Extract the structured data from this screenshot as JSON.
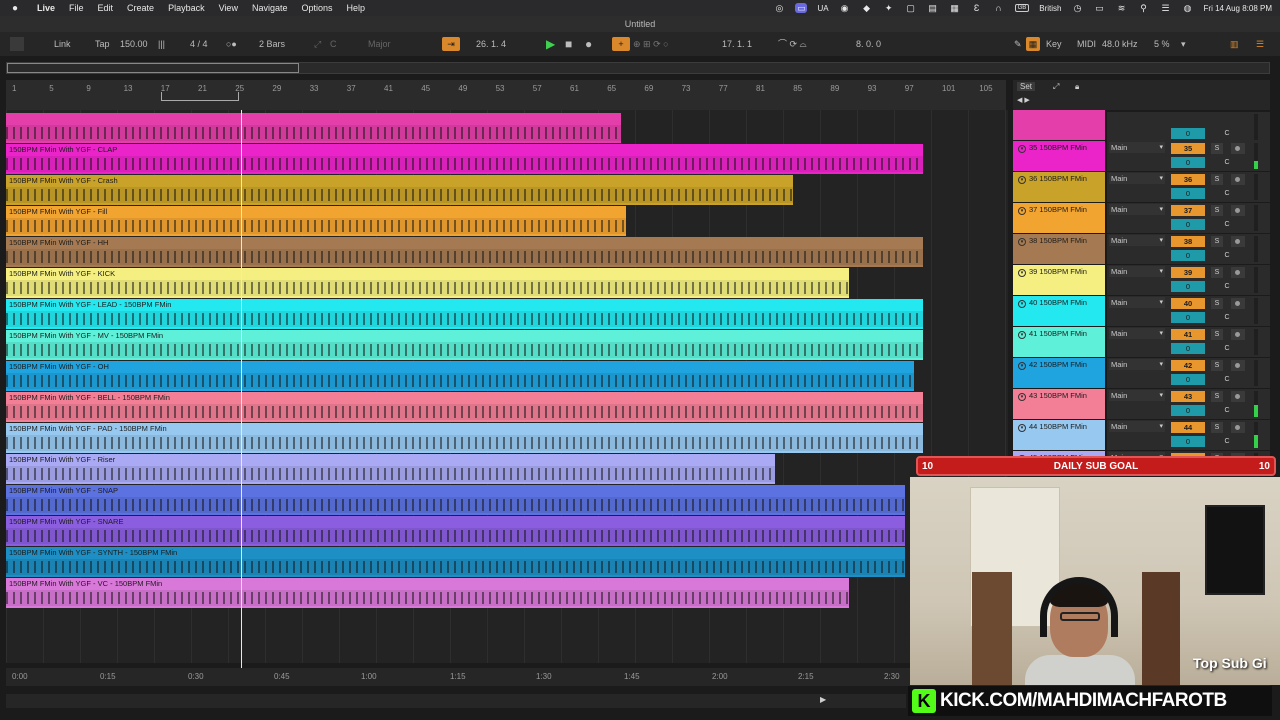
{
  "menubar": {
    "app_name": "Live",
    "items": [
      "File",
      "Edit",
      "Create",
      "Playback",
      "View",
      "Navigate",
      "Options",
      "Help"
    ],
    "status": {
      "ua": "UA",
      "keyboard": "GB",
      "keyboard_label": "British",
      "datetime": "Fri 14 Aug  8:08 PM"
    }
  },
  "window": {
    "title": "Untitled"
  },
  "control_bar": {
    "link": "Link",
    "tap": "Tap",
    "tempo": "150.00",
    "signature_sep": "4  /  4",
    "quant": "2 Bars",
    "key_root": "C",
    "scale": "Major",
    "position": "26.  1.  4",
    "loop_start": "17.  1.  1",
    "loop_length": "8.  0.  0",
    "key_label": "Key",
    "midi_label": "MIDI",
    "sample_rate": "48.0 kHz",
    "cpu": "5 %"
  },
  "ruler": {
    "bars": [
      "1",
      "5",
      "9",
      "13",
      "17",
      "21",
      "25",
      "29",
      "33",
      "37",
      "41",
      "45",
      "49",
      "53",
      "57",
      "61",
      "65",
      "69",
      "73",
      "77",
      "81",
      "85",
      "89",
      "93",
      "97",
      "101",
      "105"
    ],
    "set_label": "Set"
  },
  "tracks": [
    {
      "clip_name": "",
      "header": "",
      "route": "",
      "number": "",
      "volume": "0",
      "pan": "C",
      "color": "#e33ea9",
      "clip_end_bar": 66.5,
      "meter": 0
    },
    {
      "clip_name": "150BPM FMin With YGF - CLAP",
      "header": "35 150BPM FMin",
      "route": "Main",
      "number": "35",
      "volume": "0",
      "pan": "C",
      "color": "#ea24c9",
      "clip_end_bar": 99,
      "meter": 0.3
    },
    {
      "clip_name": "150BPM FMin With YGF - Crash",
      "header": "36 150BPM FMin",
      "route": "Main",
      "number": "36",
      "volume": "0",
      "pan": "C",
      "color": "#c9a22a",
      "clip_end_bar": 85,
      "meter": 0
    },
    {
      "clip_name": "150BPM FMin With YGF - Fill",
      "header": "37 150BPM FMin",
      "route": "Main",
      "number": "37",
      "volume": "0",
      "pan": "C",
      "color": "#f2a431",
      "clip_end_bar": 67,
      "meter": 0
    },
    {
      "clip_name": "150BPM FMin With YGF - HH",
      "header": "38 150BPM FMin",
      "route": "Main",
      "number": "38",
      "volume": "0",
      "pan": "C",
      "color": "#a57a52",
      "clip_end_bar": 99,
      "meter": 0
    },
    {
      "clip_name": "150BPM FMin With YGF - KICK",
      "header": "39 150BPM FMin",
      "route": "Main",
      "number": "39",
      "volume": "0",
      "pan": "C",
      "color": "#f4ef80",
      "clip_end_bar": 91,
      "meter": 0
    },
    {
      "clip_name": "150BPM FMin With YGF - LEAD - 150BPM FMin",
      "header": "40 150BPM FMin",
      "route": "Main",
      "number": "40",
      "volume": "0",
      "pan": "C",
      "color": "#24e8f0",
      "clip_end_bar": 99,
      "meter": 0
    },
    {
      "clip_name": "150BPM FMin With YGF - MV - 150BPM FMin",
      "header": "41 150BPM FMin",
      "route": "Main",
      "number": "41",
      "volume": "0",
      "pan": "C",
      "color": "#5ef0d8",
      "clip_end_bar": 99,
      "meter": 0
    },
    {
      "clip_name": "150BPM FMin With YGF - OH",
      "header": "42 150BPM FMin",
      "route": "Main",
      "number": "42",
      "volume": "0",
      "pan": "C",
      "color": "#1fa4e0",
      "clip_end_bar": 98,
      "meter": 0
    },
    {
      "clip_name": "150BPM FMin With YGF - BELL - 150BPM FMin",
      "header": "43 150BPM FMin",
      "route": "Main",
      "number": "43",
      "volume": "0",
      "pan": "C",
      "color": "#f27f96",
      "clip_end_bar": 99,
      "meter": 0.45
    },
    {
      "clip_name": "150BPM FMin With YGF - PAD - 150BPM FMin",
      "header": "44 150BPM FMin",
      "route": "Main",
      "number": "44",
      "volume": "0",
      "pan": "C",
      "color": "#97c8f0",
      "clip_end_bar": 99,
      "meter": 0.5
    },
    {
      "clip_name": "150BPM FMin With YGF - Riser",
      "header": "45 150BPM FMin",
      "route": "Main",
      "number": "45",
      "volume": "",
      "pan": "",
      "color": "#a9a9f4",
      "clip_end_bar": 83,
      "meter": 0
    },
    {
      "clip_name": "150BPM FMin With YGF - SNAP",
      "header": "",
      "route": "",
      "number": "",
      "volume": "",
      "pan": "",
      "color": "#5b72e0",
      "clip_end_bar": 97,
      "meter": 0
    },
    {
      "clip_name": "150BPM FMin With YGF - SNARE",
      "header": "",
      "route": "",
      "number": "",
      "volume": "",
      "pan": "",
      "color": "#8b5ee0",
      "clip_end_bar": 97,
      "meter": 0
    },
    {
      "clip_name": "150BPM FMin With YGF - SYNTH - 150BPM FMin",
      "header": "",
      "route": "",
      "number": "",
      "volume": "",
      "pan": "",
      "color": "#1d8fc4",
      "clip_end_bar": 97,
      "meter": 0
    },
    {
      "clip_name": "150BPM FMin With YGF - VC - 150BPM FMin",
      "header": "",
      "route": "",
      "number": "",
      "volume": "",
      "pan": "",
      "color": "#d878d8",
      "clip_end_bar": 91,
      "meter": 0
    }
  ],
  "timeline": {
    "labels": [
      "0:00",
      "0:15",
      "0:30",
      "0:45",
      "1:00",
      "1:15",
      "1:30",
      "1:45",
      "2:00",
      "2:15",
      "2:30"
    ]
  },
  "overlay": {
    "sub_goal_left": "10",
    "sub_goal_title": "DAILY SUB GOAL",
    "sub_goal_right": "10",
    "top_sub": "Top Sub Gi",
    "kick_url": "KICK.COM/MAHDIMACHFAROTB",
    "kick_logo": "K"
  }
}
